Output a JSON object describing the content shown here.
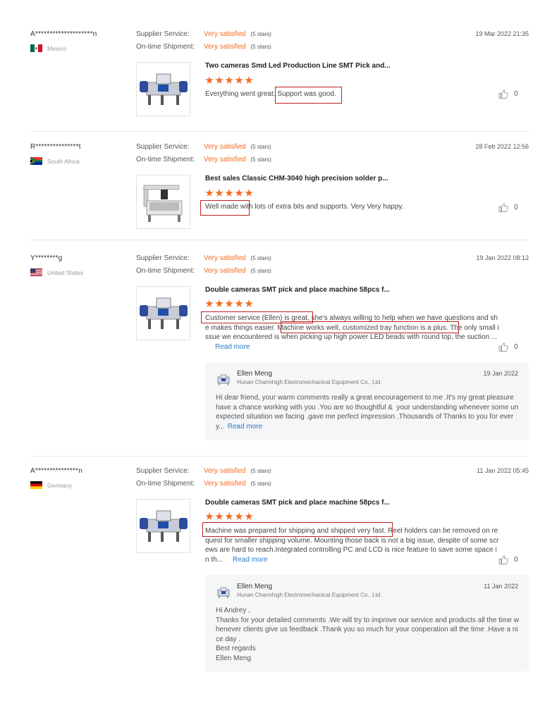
{
  "labels": {
    "supplier_service": "Supplier Service:",
    "ontime_shipment": "On-time Shipment:",
    "read_more": "Read more"
  },
  "colors": {
    "accent": "#f26b21",
    "link": "#2b78c8",
    "highlight_box": "#c0201c"
  },
  "reviews": [
    {
      "buyer": "A********************n",
      "country": "Mexico",
      "flag": "mexico-flag",
      "supplier_service": "Very satisfied",
      "supplier_stars": "(5 stars)",
      "shipment": "Very satisfied",
      "shipment_stars": "(5 stars)",
      "date": "19 Mar 2022 21:35",
      "product_title": "Two cameras Smd Led Production Line SMT Pick and...",
      "rating": 5,
      "comment": "Everything went great. Support was good.",
      "likes": "0"
    },
    {
      "buyer": "R***************t",
      "country": "South Africa",
      "flag": "south-africa-flag",
      "supplier_service": "Very satisfied",
      "supplier_stars": "(5 stars)",
      "shipment": "Very satisfied",
      "shipment_stars": "(5 stars)",
      "date": "28 Feb 2022 12:56",
      "product_title": "Best sales Classic CHM-3040 high precision solder p...",
      "rating": 5,
      "comment": "Well made with lots of extra bits and supports. Very Very happy.",
      "likes": "0"
    },
    {
      "buyer": "Y********g",
      "country": "United States",
      "flag": "us-flag",
      "supplier_service": "Very satisfied",
      "supplier_stars": "(5 stars)",
      "shipment": "Very satisfied",
      "shipment_stars": "(5 stars)",
      "date": "19 Jan 2022 08:12",
      "product_title": "Double cameras SMT pick and place machine 58pcs f...",
      "rating": 5,
      "comment": "Customer service (Ellen) is great, she's always willing to help when we have questions and she makes things easier. Machine works well, customized tray function is a plus. The only small issue we encountered is when picking up high power LED beads with round top, the suction ...",
      "likes": "0",
      "reply": {
        "name": "Ellen Meng",
        "company": "Hunan Charmhigh Electromechanical Equipment Co., Ltd.",
        "date": "19 Jan 2022",
        "text": "Hi dear friend, your warm comments really a great encouragement to me .It's my great pleasure have a chance working with you .You are so thoughtful &  your understanding whenever some unexpected situation we facing .gave me perfect impression .Thousands of Thanks to you for every..."
      }
    },
    {
      "buyer": "A***************n",
      "country": "Germany",
      "flag": "germany-flag",
      "supplier_service": "Very satisfied",
      "supplier_stars": "(5 stars)",
      "shipment": "Very satisfied",
      "shipment_stars": "(5 stars)",
      "date": "11 Jan 2022 05:45",
      "product_title": "Double cameras SMT pick and place machine 58pcs f...",
      "rating": 5,
      "comment": "Machine was prepared for shipping and shipped very fast. Reel holders can be removed on request for smaller shipping volume. Mounting those back is not a big issue, despite of some screws are hard to reach.Integrated controlling PC and LCD is nice feature to save some space in th...",
      "likes": "0",
      "reply": {
        "name": "Ellen Meng",
        "company": "Hunan Charmhigh Electromechanical Equipment Co., Ltd.",
        "date": "11 Jan 2022",
        "text": "Hi Andrey ,\nThanks for your detailed comments .We will try to improve our service and products all the time whenever clients give us feedback .Thank you so much for your cooperation all the time .Have a nice day .\nBest regards\nEllen Meng"
      }
    }
  ]
}
